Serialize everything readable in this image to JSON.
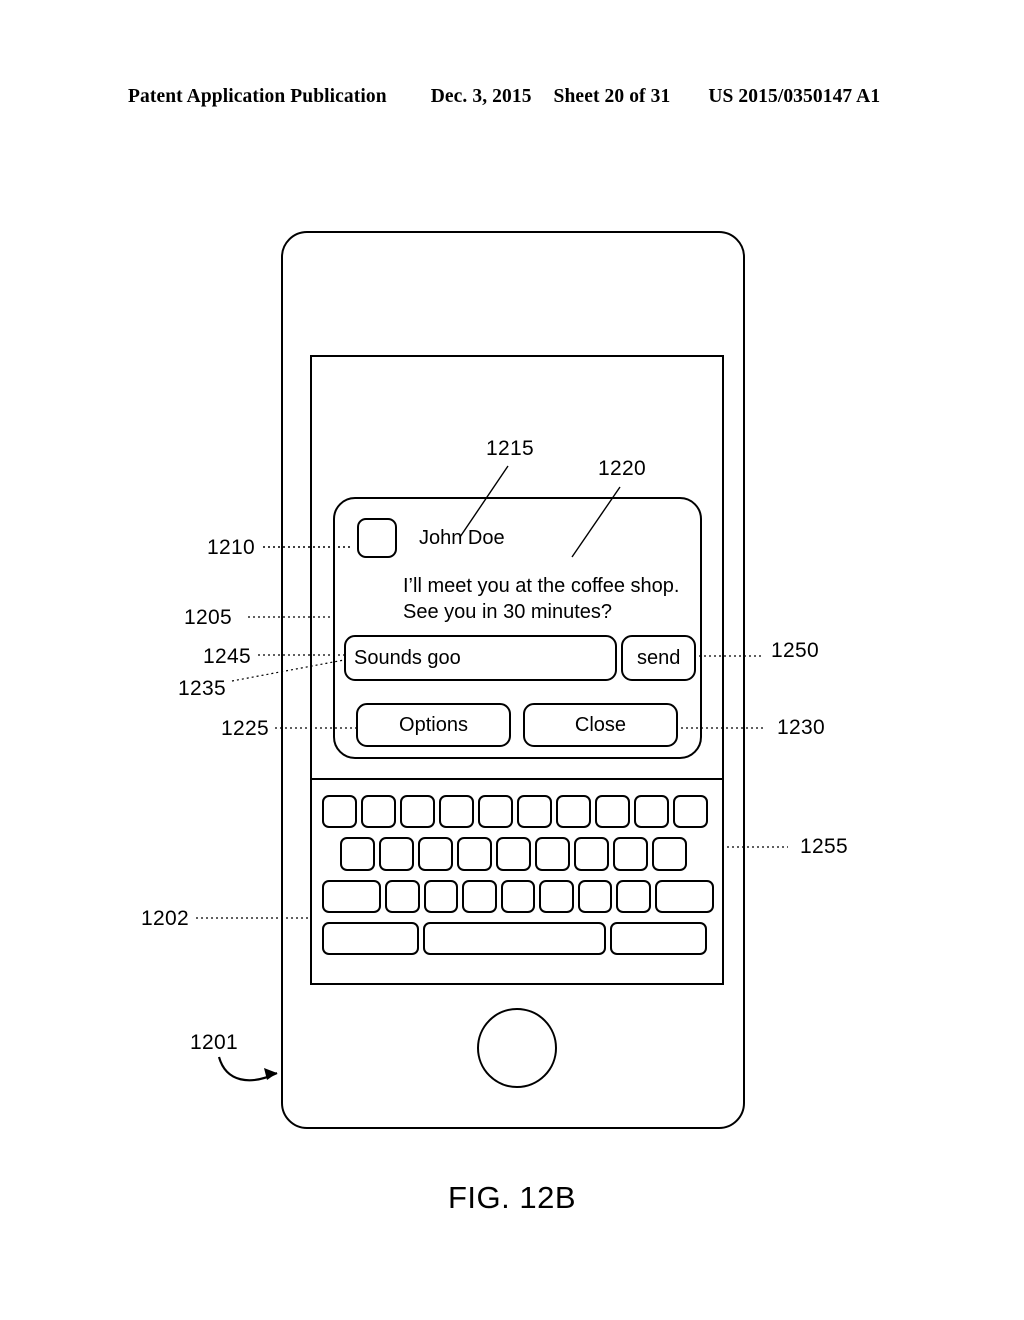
{
  "header": {
    "publication": "Patent Application Publication",
    "date": "Dec. 3, 2015",
    "sheet": "Sheet 20 of 31",
    "number": "US 2015/0350147 A1"
  },
  "figure": {
    "caption": "FIG. 12B"
  },
  "dialog": {
    "contact_name": "John Doe",
    "message": "I’ll meet you at the coffee shop.\nSee you in 30 minutes?",
    "input_value": "Sounds goo",
    "send_label": "send",
    "options_label": "Options",
    "close_label": "Close"
  },
  "reference_numerals": {
    "device": "1201",
    "keyboard_area": "1202",
    "dialog_box": "1205",
    "avatar": "1210",
    "contact_name_ref": "1215",
    "message_ref": "1220",
    "options_ref": "1225",
    "close_ref": "1230",
    "input_field_ref": "1235",
    "input_text_ref": "1245",
    "send_ref": "1250",
    "keyboard_ref": "1255"
  },
  "keyboard": {
    "row1_count": 10,
    "row2_count": 9,
    "row3_count": 9,
    "row4_count": 3
  }
}
